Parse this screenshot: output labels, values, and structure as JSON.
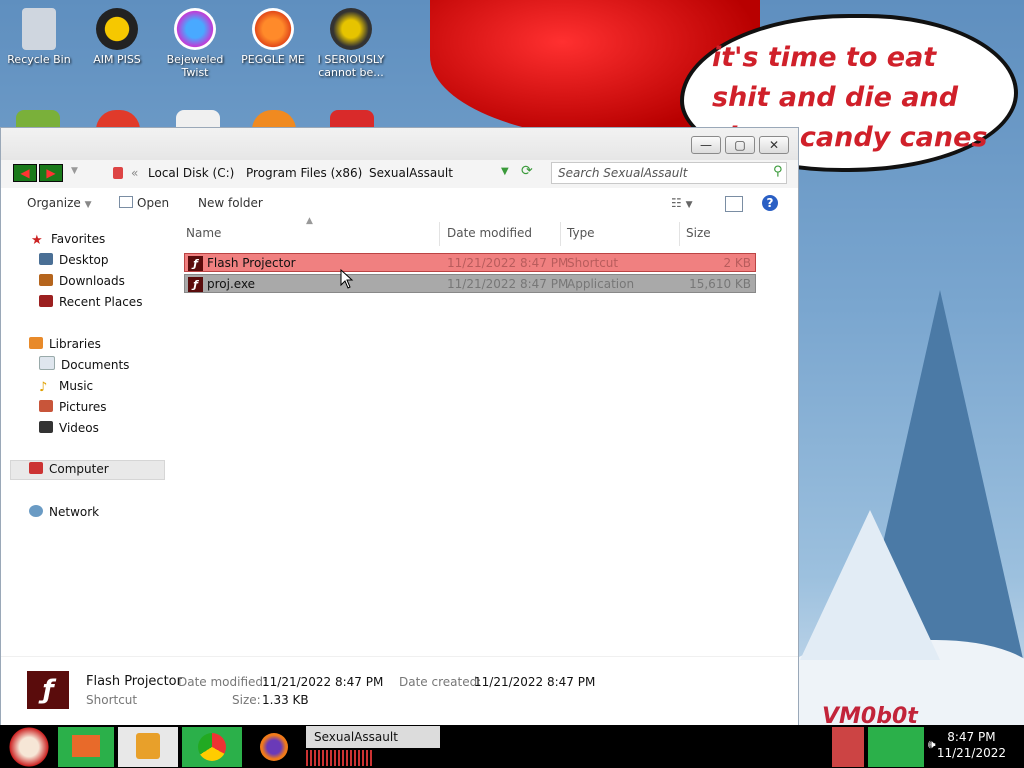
{
  "desktop": {
    "icons": [
      {
        "label": "Recycle Bin",
        "icon": "recycle-bin-icon",
        "color": "#cfd6df"
      },
      {
        "label": "AIM PISS",
        "icon": "aim-icon",
        "color": "#e0a800"
      },
      {
        "label": "Bejeweled Twist",
        "icon": "gem-icon",
        "color": "#c13bd6"
      },
      {
        "label": "PEGGLE ME",
        "icon": "peggle-icon",
        "color": "#e24a1a"
      },
      {
        "label": "I SERIOUSLY cannot be...",
        "icon": "crow-icon",
        "color": "#8c7a10"
      }
    ],
    "wallpaper_text": "it's time to eat shit and die and chew candy canes",
    "signature": "VM0b0t"
  },
  "window": {
    "title_buttons": {
      "minimize": "—",
      "maximize": "▢",
      "close": "✕"
    },
    "nav": {
      "back": "◀",
      "forward": "▶"
    },
    "breadcrumb": [
      "Local Disk (C:)",
      "Program Files (x86)",
      "SexualAssault"
    ],
    "breadcrumb_prefix": "«",
    "search_placeholder": "Search SexualAssault",
    "toolbar": {
      "organize": "Organize",
      "open": "Open",
      "new_folder": "New folder"
    },
    "navpane": {
      "favorites": "Favorites",
      "favorites_items": [
        "Desktop",
        "Downloads",
        "Recent Places"
      ],
      "libraries": "Libraries",
      "libraries_items": [
        "Documents",
        "Music",
        "Pictures",
        "Videos"
      ],
      "computer": "Computer",
      "network": "Network"
    },
    "columns": {
      "name": "Name",
      "date": "Date modified",
      "type": "Type",
      "size": "Size"
    },
    "files": [
      {
        "name": "Flash Projector",
        "date": "11/21/2022 8:47 PM",
        "type": "Shortcut",
        "size": "2 KB"
      },
      {
        "name": "proj.exe",
        "date": "11/21/2022 8:47 PM",
        "type": "Application",
        "size": "15,610 KB"
      }
    ],
    "details": {
      "name": "Flash Projector",
      "kind": "Shortcut",
      "date_modified_label": "Date modified:",
      "date_modified": "11/21/2022 8:47 PM",
      "date_created_label": "Date created:",
      "date_created": "11/21/2022 8:47 PM",
      "size_label": "Size:",
      "size": "1.33 KB"
    }
  },
  "taskbar": {
    "active_window": "SexualAssault",
    "time": "8:47 PM",
    "date": "11/21/2022"
  },
  "colors": {
    "selected_row": "#f08080",
    "secondary_row": "#a9a9a9",
    "accent_red": "#d0202a",
    "nav_green": "#1b7a1b"
  }
}
